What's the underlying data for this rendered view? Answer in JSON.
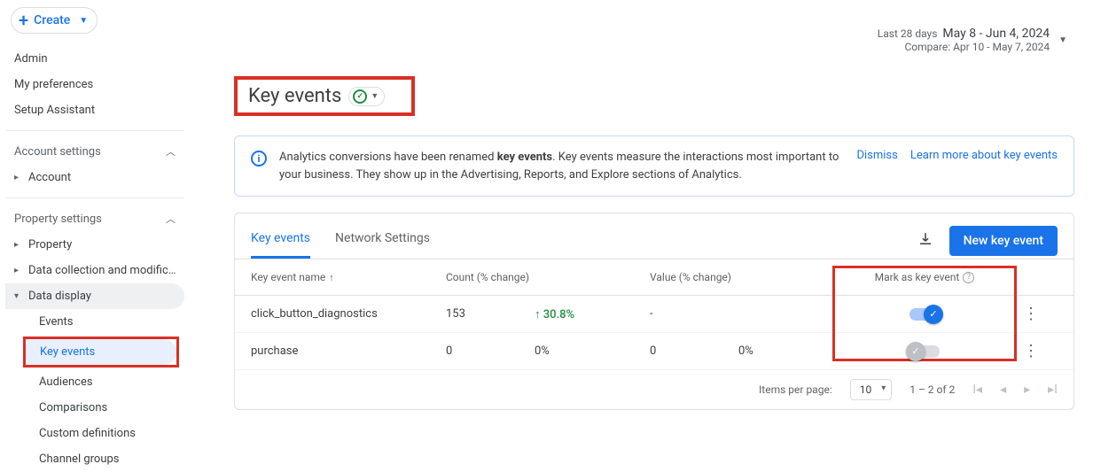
{
  "create_label": "Create",
  "sidebar": {
    "top": [
      "Admin",
      "My preferences",
      "Setup Assistant"
    ],
    "account_section": "Account settings",
    "account_items": [
      "Account"
    ],
    "property_section": "Property settings",
    "property_items": [
      "Property",
      "Data collection and modification",
      "Data display"
    ],
    "data_display_subs": [
      "Events",
      "Key events",
      "Audiences",
      "Comparisons",
      "Custom definitions",
      "Channel groups"
    ]
  },
  "date": {
    "prefix": "Last 28 days",
    "range": "May 8 - Jun 4, 2024",
    "compare": "Compare: Apr 10 - May 7, 2024"
  },
  "title": "Key events",
  "banner": {
    "text_a": "Analytics conversions have been renamed ",
    "bold": "key events",
    "text_b": ". Key events measure the interactions most important to your business. They show up in the Advertising, Reports, and Explore sections of Analytics.",
    "dismiss": "Dismiss",
    "learn": "Learn more about key events"
  },
  "tabs": [
    "Key events",
    "Network Settings"
  ],
  "new_btn": "New key event",
  "columns": {
    "name": "Key event name",
    "count": "Count (% change)",
    "value": "Value (% change)",
    "mark": "Mark as key event"
  },
  "rows": [
    {
      "name": "click_button_diagnostics",
      "count": "153",
      "count_change": "30.8%",
      "count_up": true,
      "value": "-",
      "value_change": "",
      "marked": true
    },
    {
      "name": "purchase",
      "count": "0",
      "count_change": "0%",
      "count_up": false,
      "value": "0",
      "value_change": "0%",
      "marked": false
    }
  ],
  "pager": {
    "label": "Items per page:",
    "size": "10",
    "range": "1 – 2 of 2"
  }
}
